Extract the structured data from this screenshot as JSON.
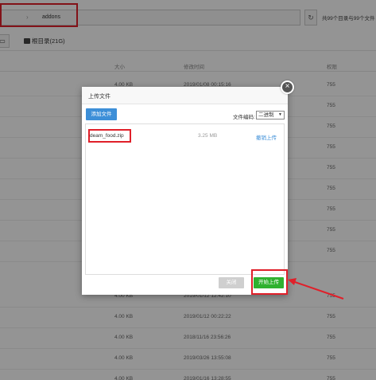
{
  "header": {
    "path_segment": "addons",
    "refresh_icon": "refresh-icon",
    "count_text": "共99个目录与99个文件"
  },
  "toolbar": {
    "root_label": "根目录(21G)"
  },
  "table": {
    "columns": [
      "大小",
      "修改时间",
      "权限"
    ],
    "rows": [
      {
        "size": "4.00 KB",
        "mtime": "2019/01/08 00:15:16",
        "perm": "755"
      },
      {
        "size": "",
        "mtime": "",
        "perm": "755"
      },
      {
        "size": "",
        "mtime": "",
        "perm": "755"
      },
      {
        "size": "",
        "mtime": "",
        "perm": "755"
      },
      {
        "size": "",
        "mtime": "",
        "perm": "755"
      },
      {
        "size": "",
        "mtime": "",
        "perm": "755"
      },
      {
        "size": "",
        "mtime": "",
        "perm": "755"
      },
      {
        "size": "",
        "mtime": "",
        "perm": "755"
      },
      {
        "size": "",
        "mtime": "",
        "perm": "755"
      },
      {
        "size": "4.00 KB",
        "mtime": "2019/01/12 12:42:10",
        "perm": "755"
      },
      {
        "size": "4.00 KB",
        "mtime": "2019/01/12 00:22:22",
        "perm": "755"
      },
      {
        "size": "4.00 KB",
        "mtime": "2018/11/16 23:56:26",
        "perm": "755"
      },
      {
        "size": "4.00 KB",
        "mtime": "2019/03/26 13:55:08",
        "perm": "755"
      },
      {
        "size": "4.00 KB",
        "mtime": "2019/01/16 13:28:55",
        "perm": "755"
      }
    ]
  },
  "dialog": {
    "title": "上传文件",
    "add_file_label": "添加文件",
    "encoding_label": "文件编码:",
    "encoding_value": "二进制",
    "file": {
      "name": "deam_food.zip",
      "size": "3.25 MB",
      "cancel_label": "撤销上传"
    },
    "close_label": "关闭",
    "start_label": "开始上传",
    "close_icon": "close-icon"
  },
  "colors": {
    "highlight_red": "#e0202a",
    "primary_blue": "#3d8fd8",
    "start_green": "#2fb12f"
  }
}
